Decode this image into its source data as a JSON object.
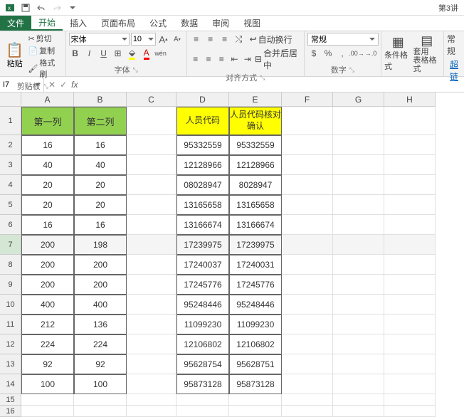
{
  "app": {
    "doc_title": "第3讲"
  },
  "qat": {
    "excel": "x",
    "save": "save-icon",
    "undo": "undo-icon",
    "redo": "redo-icon"
  },
  "tabs": {
    "file": "文件",
    "home": "开始",
    "insert": "插入",
    "layout": "页面布局",
    "formulas": "公式",
    "data": "数据",
    "review": "审阅",
    "view": "视图"
  },
  "ribbon": {
    "clipboard": {
      "paste": "粘贴",
      "cut": "剪切",
      "copy": "复制",
      "painter": "格式刷",
      "label": "剪贴板"
    },
    "font": {
      "name": "宋体",
      "size": "10",
      "label": "字体",
      "A_plus": "A",
      "A_minus": "A",
      "wen": "wén"
    },
    "align": {
      "wrap": "自动换行",
      "merge": "合并后居中",
      "label": "对齐方式"
    },
    "number": {
      "format": "常规",
      "label": "数字"
    },
    "styles": {
      "cond": "条件格式",
      "table": "套用\n表格格式"
    },
    "cells": {
      "label": "常规",
      "link": "超链"
    }
  },
  "namebox": {
    "ref": "I7"
  },
  "cols": [
    "A",
    "B",
    "C",
    "D",
    "E",
    "F",
    "G",
    "H"
  ],
  "headers": {
    "a": "第一列",
    "b": "第二列",
    "d": "人员代码",
    "e": "人员代码核对确认"
  },
  "rows": [
    {
      "n": "2",
      "a": "16",
      "b": "16",
      "d": "95332559",
      "e": "95332559"
    },
    {
      "n": "3",
      "a": "40",
      "b": "40",
      "d": "12128966",
      "e": "12128966"
    },
    {
      "n": "4",
      "a": "20",
      "b": "20",
      "d": "08028947",
      "e": "8028947"
    },
    {
      "n": "5",
      "a": "20",
      "b": "20",
      "d": "13165658",
      "e": "13165658"
    },
    {
      "n": "6",
      "a": "16",
      "b": "16",
      "d": "13166674",
      "e": "13166674"
    },
    {
      "n": "7",
      "a": "200",
      "b": "198",
      "d": "17239975",
      "e": "17239975"
    },
    {
      "n": "8",
      "a": "200",
      "b": "200",
      "d": "17240037",
      "e": "17240031"
    },
    {
      "n": "9",
      "a": "200",
      "b": "200",
      "d": "17245776",
      "e": "17245776"
    },
    {
      "n": "10",
      "a": "400",
      "b": "400",
      "d": "95248446",
      "e": "95248446"
    },
    {
      "n": "11",
      "a": "212",
      "b": "136",
      "d": "11099230",
      "e": "11099230"
    },
    {
      "n": "12",
      "a": "224",
      "b": "224",
      "d": "12106802",
      "e": "12106802"
    },
    {
      "n": "13",
      "a": "92",
      "b": "92",
      "d": "95628754",
      "e": "95628751"
    },
    {
      "n": "14",
      "a": "100",
      "b": "100",
      "d": "95873128",
      "e": "95873128"
    }
  ],
  "extra_rows": [
    "15",
    "16"
  ]
}
